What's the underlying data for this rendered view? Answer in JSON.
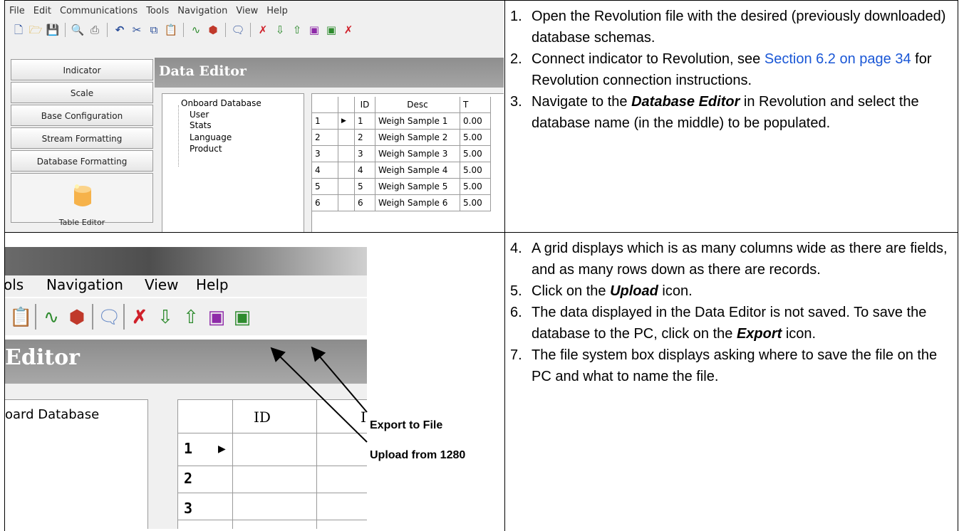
{
  "row1": {
    "app": {
      "menu": [
        "File",
        "Edit",
        "Communications",
        "Tools",
        "Navigation",
        "View",
        "Help"
      ],
      "toolbar_icons": [
        "new-icon",
        "open-icon",
        "save-icon",
        "print-preview-icon",
        "print-icon",
        "undo-icon",
        "cut-icon",
        "copy-icon",
        "paste-icon",
        "connect-icon",
        "disconnect-icon",
        "comment-icon",
        "delete-icon",
        "download-icon",
        "upload-icon",
        "export-icon",
        "import-icon",
        "clear-icon"
      ],
      "sidebar": [
        "Indicator",
        "Scale",
        "Base Configuration",
        "Stream Formatting",
        "Database Formatting",
        "Table Editor"
      ],
      "header": "Data Editor",
      "tree": {
        "root": "Onboard Database",
        "children": [
          "User",
          "Stats",
          "Language",
          "Product"
        ]
      },
      "grid": {
        "columns": [
          "",
          "ID",
          "Desc",
          "T"
        ],
        "rows": [
          [
            "1",
            "1",
            "Weigh Sample 1",
            "0.00"
          ],
          [
            "2",
            "2",
            "Weigh Sample 2",
            "5.00"
          ],
          [
            "3",
            "3",
            "Weigh Sample 3",
            "5.00"
          ],
          [
            "4",
            "4",
            "Weigh Sample 4",
            "5.00"
          ],
          [
            "5",
            "5",
            "Weigh Sample 5",
            "5.00"
          ],
          [
            "6",
            "6",
            "Weigh Sample 6",
            "5.00"
          ]
        ]
      }
    },
    "steps": [
      {
        "n": "1.",
        "text": "Open the Revolution file with the desired (previously downloaded) database schemas."
      },
      {
        "n": "2.",
        "pre": "Connect indicator to Revolution, see ",
        "link": "Section 6.2 on page 34",
        "post": " for Revolution connection instructions."
      },
      {
        "n": "3.",
        "pre": "Navigate to the ",
        "em": "Database Editor",
        "post": " in Revolution and select the database name (in the middle) to be populated."
      }
    ]
  },
  "row2": {
    "zoom": {
      "menu": [
        "ols",
        "Navigation",
        "View",
        "Help"
      ],
      "header": "Editor",
      "tree_root": "oard Database",
      "grid_col": "ID",
      "grid_col2": "I",
      "rows": [
        "1",
        "2",
        "3"
      ],
      "callouts": {
        "export": "Export to File",
        "upload": "Upload from 1280"
      }
    },
    "steps": [
      {
        "n": "4.",
        "text": "A grid displays which is as many columns wide as there are fields, and as many rows down as there are records."
      },
      {
        "n": "5.",
        "pre": "Click on the ",
        "em": "Upload",
        "post": " icon."
      },
      {
        "n": "6.",
        "pre": "The data displayed in the Data Editor is not saved. To save the database to the PC, click on the ",
        "em": "Export",
        "post": " icon."
      },
      {
        "n": "7.",
        "text": "The file system box displays asking where to save the file on the PC and what to name the file."
      }
    ]
  }
}
